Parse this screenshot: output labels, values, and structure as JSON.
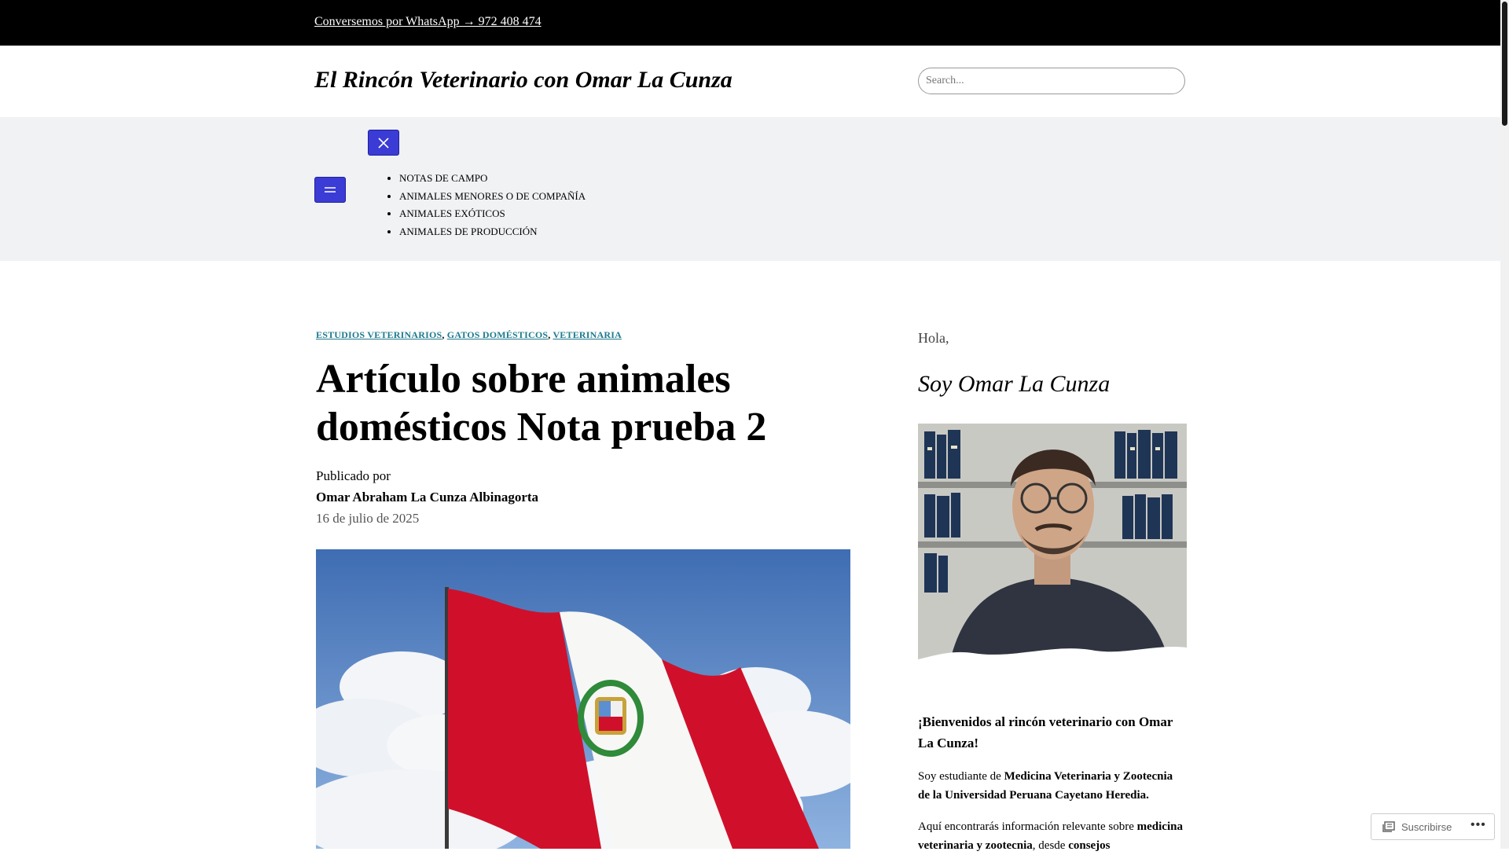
{
  "topbar": {
    "whatsapp_link": "Conversemos por WhatsApp → 972 408 474"
  },
  "header": {
    "site_title": "El Rincón Veterinario con Omar La Cunza",
    "search_placeholder": "Search..."
  },
  "nav": {
    "items": [
      {
        "label": "NOTAS DE CAMPO"
      },
      {
        "label": "ANIMALES MENORES O DE COMPAÑÍA"
      },
      {
        "label": "ANIMALES EXÓTICOS"
      },
      {
        "label": "ANIMALES DE PRODUCCIÓN"
      }
    ],
    "accent_color": "#3b3bd6"
  },
  "post": {
    "categories": [
      "ESTUDIOS VETERINARIOS",
      "GATOS DOMÉSTICOS",
      "VETERINARIA"
    ],
    "title": "Artículo sobre animales domésticos Nota prueba 2",
    "published_by": "Publicado por",
    "author": "Omar Abraham La Cunza Albinagorta",
    "date": "16 de julio de 2025",
    "hero_image": "peru-flag"
  },
  "sidebar": {
    "greeting": "Hola,",
    "heading": "Soy Omar La Cunza",
    "portrait_image": "author-portrait",
    "welcome": "¡Bienvenidos al rincón veterinario con Omar La Cunza!",
    "para1_prefix": "Soy estudiante de ",
    "para1_bold": "Medicina Veterinaria y Zootecnia de la Universidad Peruana Cayetano Heredia.",
    "para2_prefix": "Aquí encontrarás información relevante sobre ",
    "para2_bold": "medicina veterinaria y zootecnia",
    "para2_mid": ", desde ",
    "para2_bold2": "consejos"
  },
  "subscribe": {
    "label": "Suscribirse",
    "more": "•••"
  }
}
